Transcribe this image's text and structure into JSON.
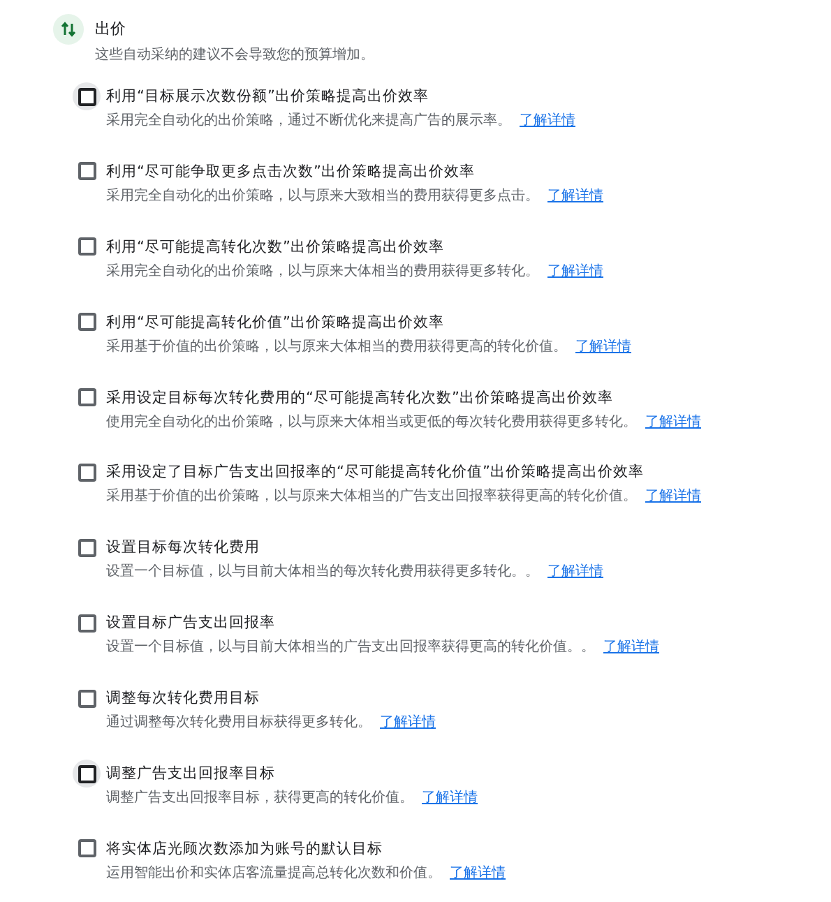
{
  "section": {
    "title": "出价",
    "subtitle": "这些自动采纳的建议不会导致您的预算增加。"
  },
  "items": [
    {
      "title": "利用“目标展示次数份额”出价策略提高出价效率",
      "description": "采用完全自动化的出价策略，通过不断优化来提高广告的展示率。",
      "link": "了解详情",
      "checked": false,
      "focused": true
    },
    {
      "title": "利用“尽可能争取更多点击次数”出价策略提高出价效率",
      "description": "采用完全自动化的出价策略，以与原来大致相当的费用获得更多点击。",
      "link": "了解详情",
      "checked": false,
      "focused": false
    },
    {
      "title": "利用“尽可能提高转化次数”出价策略提高出价效率",
      "description": "采用完全自动化的出价策略，以与原来大体相当的费用获得更多转化。",
      "link": "了解详情",
      "checked": false,
      "focused": false
    },
    {
      "title": "利用“尽可能提高转化价值”出价策略提高出价效率",
      "description": "采用基于价值的出价策略，以与原来大体相当的费用获得更高的转化价值。",
      "link": "了解详情",
      "checked": false,
      "focused": false
    },
    {
      "title": "采用设定目标每次转化费用的“尽可能提高转化次数”出价策略提高出价效率",
      "description": "使用完全自动化的出价策略，以与原来大体相当或更低的每次转化费用获得更多转化。",
      "link": "了解详情",
      "checked": false,
      "focused": false
    },
    {
      "title": "采用设定了目标广告支出回报率的“尽可能提高转化价值”出价策略提高出价效率",
      "description": "采用基于价值的出价策略，以与原来大体相当的广告支出回报率获得更高的转化价值。",
      "link": "了解详情",
      "checked": false,
      "focused": false
    },
    {
      "title": "设置目标每次转化费用",
      "description": "设置一个目标值，以与目前大体相当的每次转化费用获得更多转化。。",
      "link": "了解详情",
      "checked": false,
      "focused": false
    },
    {
      "title": "设置目标广告支出回报率",
      "description": "设置一个目标值，以与目前大体相当的广告支出回报率获得更高的转化价值。。",
      "link": "了解详情",
      "checked": false,
      "focused": false
    },
    {
      "title": "调整每次转化费用目标",
      "description": "通过调整每次转化费用目标获得更多转化。",
      "link": "了解详情",
      "checked": false,
      "focused": false
    },
    {
      "title": "调整广告支出回报率目标",
      "description": "调整广告支出回报率目标，获得更高的转化价值。",
      "link": "了解详情",
      "checked": false,
      "focused": true
    },
    {
      "title": "将实体店光顾次数添加为账号的默认目标",
      "description": "运用智能出价和实体店客流量提高总转化次数和价值。",
      "link": "了解详情",
      "checked": false,
      "focused": false
    }
  ]
}
